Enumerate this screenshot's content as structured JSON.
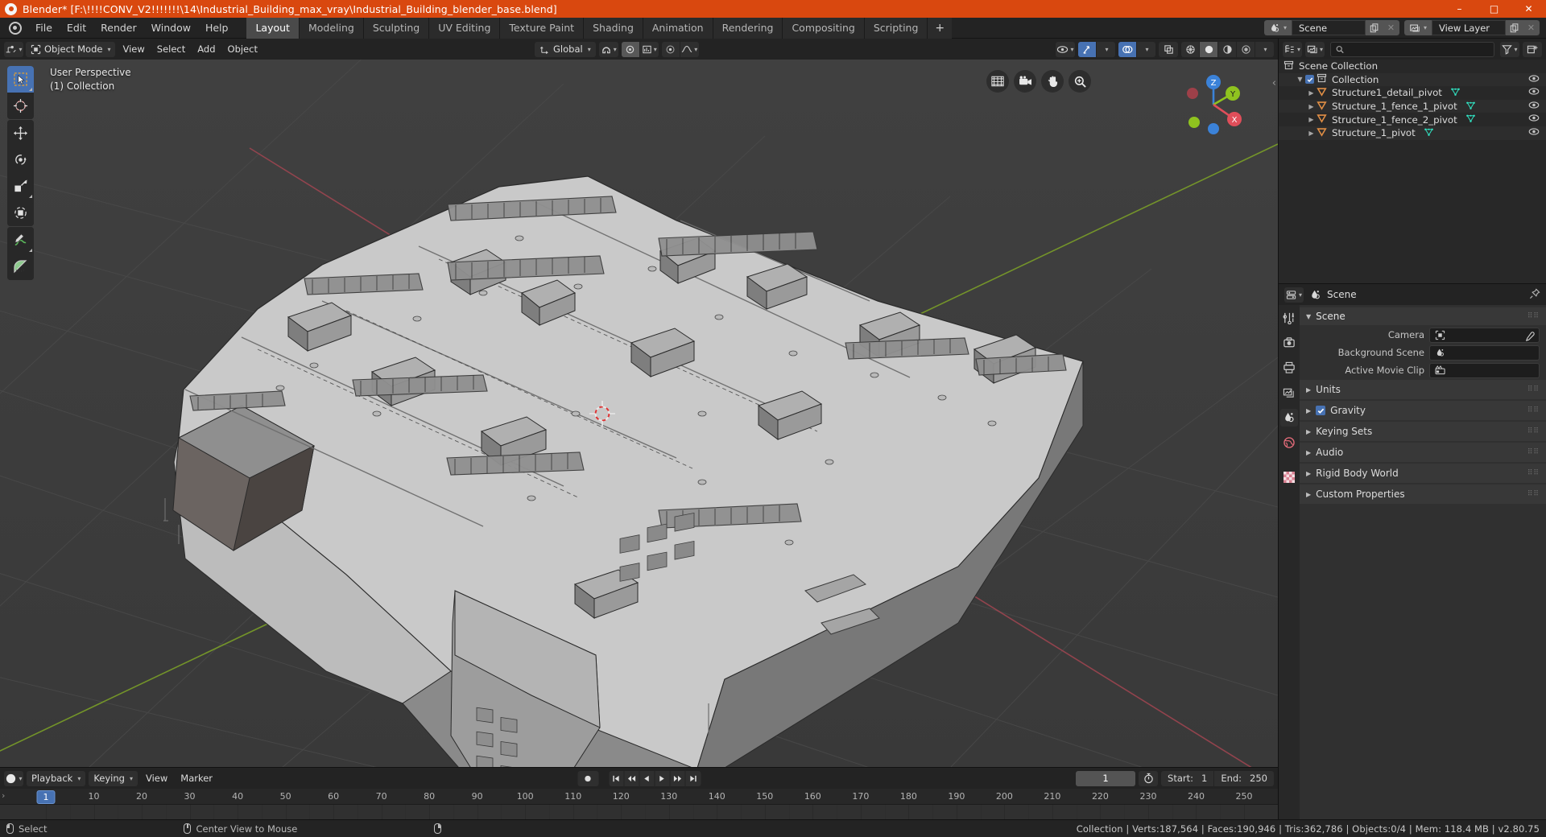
{
  "window": {
    "title": "Blender* [F:\\!!!!CONV_V2!!!!!!!\\14\\Industrial_Building_max_vray\\Industrial_Building_blender_base.blend]",
    "minimize": "–",
    "maximize": "□",
    "close": "✕"
  },
  "topbar": {
    "menus": [
      "File",
      "Edit",
      "Render",
      "Window",
      "Help"
    ],
    "workspaces": [
      {
        "label": "Layout",
        "active": true
      },
      {
        "label": "Modeling",
        "active": false
      },
      {
        "label": "Sculpting",
        "active": false
      },
      {
        "label": "UV Editing",
        "active": false
      },
      {
        "label": "Texture Paint",
        "active": false
      },
      {
        "label": "Shading",
        "active": false
      },
      {
        "label": "Animation",
        "active": false
      },
      {
        "label": "Rendering",
        "active": false
      },
      {
        "label": "Compositing",
        "active": false
      },
      {
        "label": "Scripting",
        "active": false
      }
    ],
    "add_workspace_label": "+",
    "scene_name": "Scene",
    "view_layer_name": "View Layer"
  },
  "viewport_header": {
    "mode": "Object Mode",
    "menus": [
      "View",
      "Select",
      "Add",
      "Object"
    ],
    "transform_orientation": "Global"
  },
  "viewport": {
    "perspective_label": "User Perspective",
    "collection_label": "(1) Collection",
    "gizmo_axes": [
      "Z",
      "Y",
      "X"
    ],
    "tools": [
      "select-box-tool",
      "cursor-tool",
      "move-tool",
      "rotate-tool",
      "scale-tool",
      "transform-tool",
      "annotate-tool",
      "measure-tool"
    ],
    "nav_buttons": [
      "grid-toggle",
      "camera-view",
      "pan-view",
      "zoom-view"
    ]
  },
  "outliner": {
    "display_mode": "View Layer",
    "search_placeholder": "",
    "search_value": "",
    "rows": [
      {
        "label": "Scene Collection",
        "indent": 0,
        "icon": "collection-icon",
        "has_disclosure": false,
        "has_checkbox": false,
        "has_mesh_data": false,
        "has_eye": false
      },
      {
        "label": "Collection",
        "indent": 1,
        "icon": "collection-icon",
        "has_disclosure": true,
        "has_checkbox": true,
        "has_mesh_data": false,
        "has_eye": true
      },
      {
        "label": "Structure1_detail_pivot",
        "indent": 2,
        "icon": "empty-plain-axes-icon",
        "has_disclosure": true,
        "has_checkbox": false,
        "has_mesh_data": true,
        "has_eye": true
      },
      {
        "label": "Structure_1_fence_1_pivot",
        "indent": 2,
        "icon": "empty-plain-axes-icon",
        "has_disclosure": true,
        "has_checkbox": false,
        "has_mesh_data": true,
        "has_eye": true
      },
      {
        "label": "Structure_1_fence_2_pivot",
        "indent": 2,
        "icon": "empty-plain-axes-icon",
        "has_disclosure": true,
        "has_checkbox": false,
        "has_mesh_data": true,
        "has_eye": true
      },
      {
        "label": "Structure_1_pivot",
        "indent": 2,
        "icon": "empty-plain-axes-icon",
        "has_disclosure": true,
        "has_checkbox": false,
        "has_mesh_data": true,
        "has_eye": true
      }
    ]
  },
  "properties": {
    "breadcrumb": "Scene",
    "panel_title": "Scene",
    "fields": [
      {
        "label": "Camera",
        "value": "",
        "icon": "camera-icon",
        "has_eyedropper": true
      },
      {
        "label": "Background Scene",
        "value": "",
        "icon": "scene-icon",
        "has_eyedropper": false
      },
      {
        "label": "Active Movie Clip",
        "value": "",
        "icon": "clip-icon",
        "has_eyedropper": false
      }
    ],
    "sections": [
      {
        "label": "Units",
        "checkbox": false
      },
      {
        "label": "Gravity",
        "checkbox": true
      },
      {
        "label": "Keying Sets",
        "checkbox": false
      },
      {
        "label": "Audio",
        "checkbox": false
      },
      {
        "label": "Rigid Body World",
        "checkbox": false
      },
      {
        "label": "Custom Properties",
        "checkbox": false
      }
    ],
    "tabs": [
      "tool-tab",
      "render-tab",
      "output-tab",
      "view-layer-tab",
      "scene-tab",
      "world-tab",
      "texture-tab"
    ]
  },
  "timeline": {
    "menus": [
      "Playback",
      "Keying",
      "View",
      "Marker"
    ],
    "current_frame": "1",
    "start_label": "Start:",
    "start_value": "1",
    "end_label": "End:",
    "end_value": "250",
    "tick_labels": [
      "1",
      "10",
      "20",
      "30",
      "40",
      "50",
      "60",
      "70",
      "80",
      "90",
      "100",
      "110",
      "120",
      "130",
      "140",
      "150",
      "160",
      "170",
      "180",
      "190",
      "200",
      "210",
      "220",
      "230",
      "240",
      "250"
    ],
    "playhead_frame": "1"
  },
  "statusbar": {
    "hints": [
      {
        "mouse": "left",
        "label": "Select"
      },
      {
        "mouse": "mid",
        "label": "Center View to Mouse"
      },
      {
        "mouse": "right",
        "label": ""
      }
    ],
    "stats": "Collection | Verts:187,564 | Faces:190,946 | Tris:362,786 | Objects:0/4 | Mem: 118.4 MB | v2.80.75"
  },
  "colors": {
    "title_bar": "#d9480f",
    "accent_blue": "#4772b3",
    "empty_orange": "#e08e45",
    "mesh_teal": "#31e3c2",
    "axis_x": "#e04e5a",
    "axis_y": "#8fc31f",
    "axis_z": "#3b82d8"
  }
}
